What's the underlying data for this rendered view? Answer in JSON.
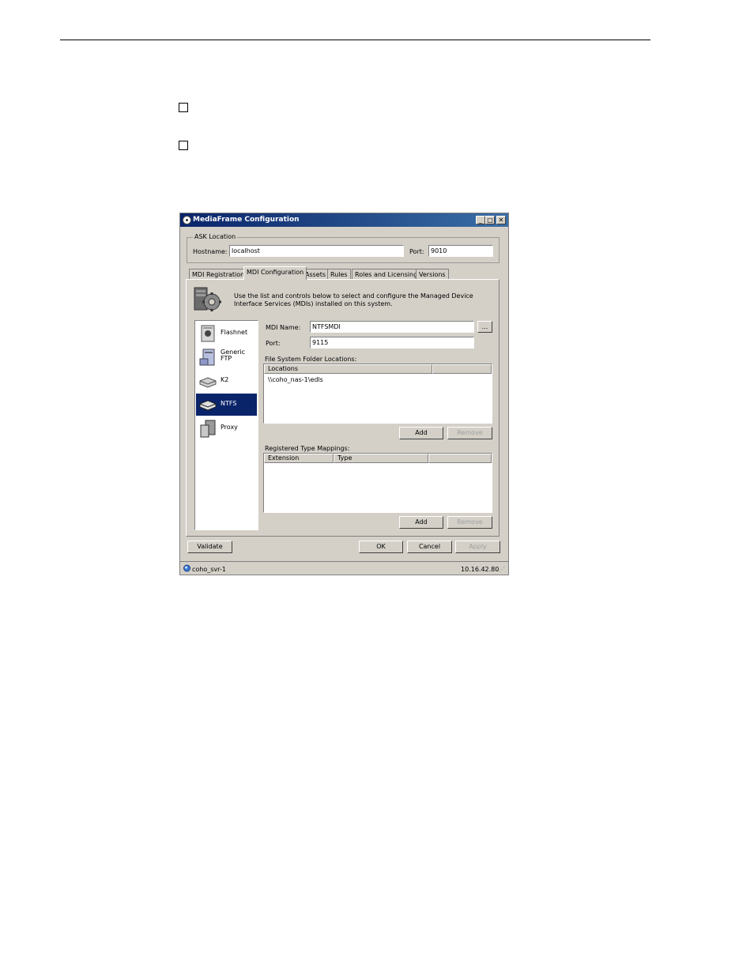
{
  "window": {
    "title": "MediaFrame Configuration",
    "controls": {
      "minimize": "_",
      "maximize": "□",
      "close": "✕"
    }
  },
  "ask_location": {
    "legend": "ASK Location",
    "hostname_label": "Hostname:",
    "hostname_value": "localhost",
    "port_label": "Port:",
    "port_value": "9010"
  },
  "tabs": [
    {
      "label": "MDI Registration"
    },
    {
      "label": "MDI Configuration",
      "active": true
    },
    {
      "label": "Assets"
    },
    {
      "label": "Rules"
    },
    {
      "label": "Roles and Licensing"
    },
    {
      "label": "Versions"
    }
  ],
  "intro_text": "Use the list and controls below to select and configure the Managed Device Interface Services (MDIs) installed on this system.",
  "mdi_list": [
    {
      "label": "Flashnet",
      "icon": "flashnet-server-icon"
    },
    {
      "label": "Generic\nFTP",
      "icon": "ftp-server-icon"
    },
    {
      "label": "K2",
      "icon": "k2-drive-icon"
    },
    {
      "label": "NTFS",
      "icon": "ntfs-drive-icon",
      "selected": true
    },
    {
      "label": "Proxy",
      "icon": "proxy-server-icon"
    }
  ],
  "mdi_config": {
    "name_label": "MDI Name:",
    "name_value": "NTFSMDI",
    "browse_label": "...",
    "port_label": "Port:",
    "port_value": "9115"
  },
  "folder_locations": {
    "title": "File System Folder Locations:",
    "columns": [
      "Locations",
      ""
    ],
    "rows": [
      "\\\\coho_nas-1\\edls"
    ],
    "add_label": "Add",
    "remove_label": "Remove"
  },
  "type_mappings": {
    "title": "Registered Type Mappings:",
    "columns": [
      "Extension",
      "Type",
      ""
    ],
    "rows": [],
    "add_label": "Add",
    "remove_label": "Remove"
  },
  "footer_buttons": {
    "validate": "Validate",
    "ok": "OK",
    "cancel": "Cancel",
    "apply": "Apply"
  },
  "status": {
    "server": "coho_svr-1",
    "ip": "10.16.42.80"
  }
}
